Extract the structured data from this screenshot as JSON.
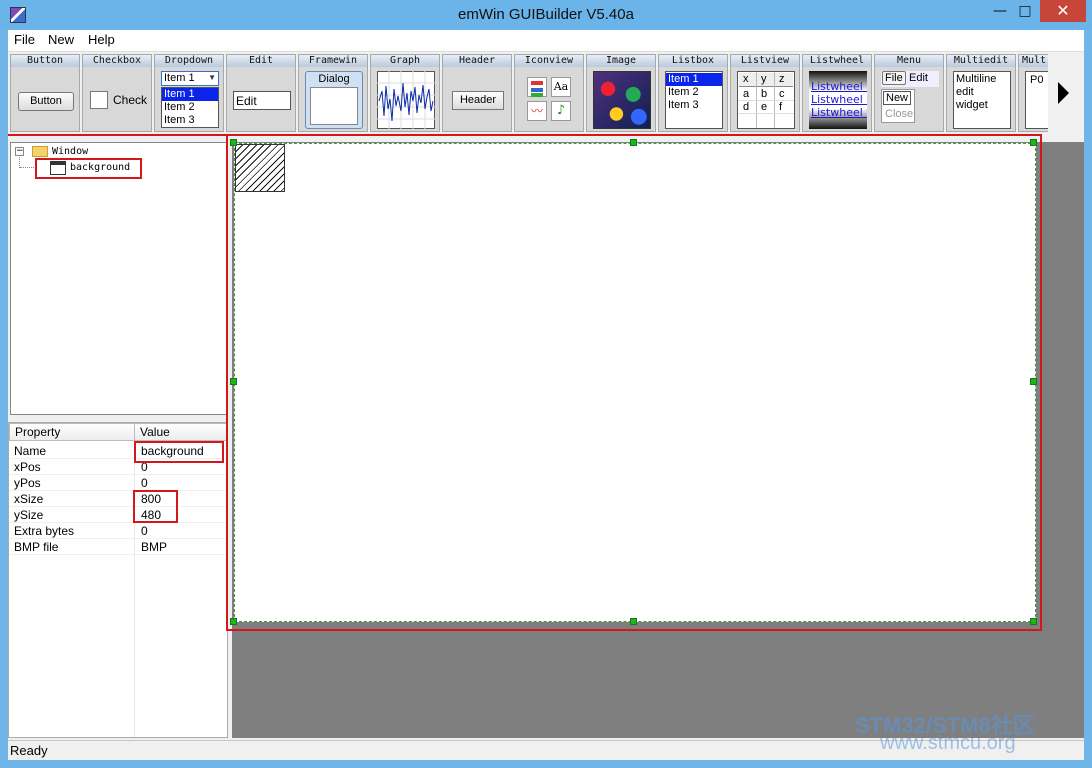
{
  "window": {
    "title": "emWin GUIBuilder V5.40a",
    "minimize": "—",
    "maximize": "□",
    "close": "✕"
  },
  "menu": [
    "File",
    "New",
    "Help"
  ],
  "toolbar": {
    "widgets": [
      "Button",
      "Checkbox",
      "Dropdown",
      "Edit",
      "Framewin",
      "Graph",
      "Header",
      "Iconview",
      "Image",
      "Listbox",
      "Listview",
      "Listwheel",
      "Menu",
      "Multiedit",
      "Mult"
    ],
    "button_label": "Button",
    "checkbox_label": "Check",
    "dropdown": {
      "selected": "Item 1",
      "items": [
        "Item 1",
        "Item 2",
        "Item 3"
      ]
    },
    "edit_text": "Edit",
    "framewin_label": "Dialog",
    "header_label": "Header",
    "iconview_font_icon": "Aa",
    "listbox_items": [
      "Item 1",
      "Item 2",
      "Item 3"
    ],
    "listview": {
      "headers": [
        "x",
        "y",
        "z"
      ],
      "rows": [
        [
          "a",
          "b",
          "c"
        ],
        [
          "d",
          "e",
          "f"
        ]
      ]
    },
    "listwheel_items": [
      "Listwheel wid",
      "Listwheel wid",
      "Listwheel wid"
    ],
    "menu_preview": {
      "top": [
        "File",
        "Edit"
      ],
      "sub": [
        "New",
        "Close"
      ]
    },
    "multiedit_lines": [
      "Multiline",
      "edit",
      "widget"
    ],
    "mult_text": "P0"
  },
  "tree": {
    "root": "Window",
    "child": "background"
  },
  "properties": {
    "headers": [
      "Property",
      "Value"
    ],
    "rows": [
      {
        "name": "Name",
        "value": "background"
      },
      {
        "name": "xPos",
        "value": "0"
      },
      {
        "name": "yPos",
        "value": "0"
      },
      {
        "name": "xSize",
        "value": "800"
      },
      {
        "name": "ySize",
        "value": "480"
      },
      {
        "name": "Extra bytes",
        "value": "0"
      },
      {
        "name": "BMP file",
        "value": "BMP"
      }
    ]
  },
  "status": "Ready",
  "watermark": {
    "line1": "STM32/STM8社区",
    "line2": "www.stmcu.org"
  }
}
